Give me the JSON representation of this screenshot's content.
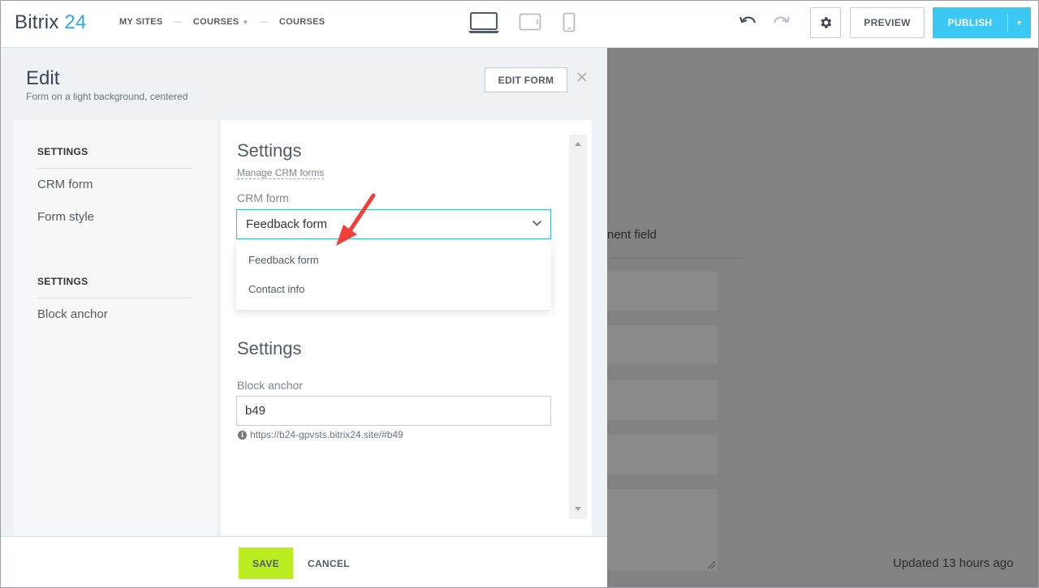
{
  "header": {
    "logo_part1": "Bitrix",
    "logo_part2": "24",
    "breadcrumb": [
      "MY SITES",
      "COURSES",
      "COURSES"
    ],
    "breadcrumb_sep": "—",
    "preview_label": "PREVIEW",
    "publish_label": "PUBLISH"
  },
  "panel": {
    "title": "Edit",
    "subtitle": "Form on a light background, centered",
    "edit_form_label": "EDIT FORM"
  },
  "sidenav": {
    "section1_heading": "SETTINGS",
    "section1_items": [
      "CRM form",
      "Form style"
    ],
    "section2_heading": "SETTINGS",
    "section2_items": [
      "Block anchor"
    ]
  },
  "content": {
    "section1_title": "Settings",
    "manage_link": "Manage CRM forms",
    "crm_form_label": "CRM form",
    "crm_form_value": "Feedback form",
    "crm_form_options": [
      "Feedback form",
      "Contact info"
    ],
    "section2_title": "Settings",
    "anchor_label": "Block anchor",
    "anchor_value": "b49",
    "anchor_url": "https://b24-gpvsts.bitrix24.site/#b49"
  },
  "footer": {
    "save_label": "SAVE",
    "cancel_label": "CANCEL"
  },
  "background_page": {
    "field_text_fragment": "nent field",
    "updated_text": "Updated 13 hours ago"
  },
  "colors": {
    "accent": "#3bc8f5",
    "save": "#bbed21",
    "arrow": "#f0403a"
  }
}
